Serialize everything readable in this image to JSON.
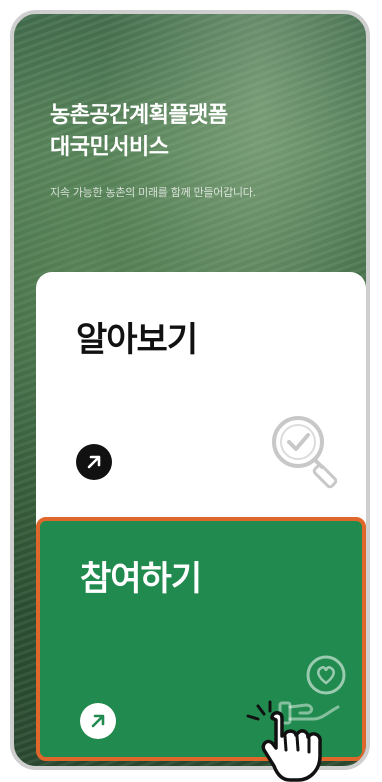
{
  "hero": {
    "title": "농촌공간계획플랫폼\n대국민서비스",
    "subtitle": "지속 가능한 농촌의 미래를 함께 만들어갑니다."
  },
  "cards": {
    "learn": {
      "title": "알아보기",
      "arrow_icon": "arrow-up-right-icon",
      "illustration_icon": "magnifier-check-icon"
    },
    "join": {
      "title": "참여하기",
      "arrow_icon": "arrow-up-right-icon",
      "illustration_icon": "hand-heart-icon"
    }
  },
  "colors": {
    "join_bg": "#218a4e",
    "join_border": "#e0672b",
    "learn_bg": "#ffffff",
    "arrow_dark": "#111111"
  },
  "cursor": {
    "icon": "hand-pointer-icon"
  }
}
